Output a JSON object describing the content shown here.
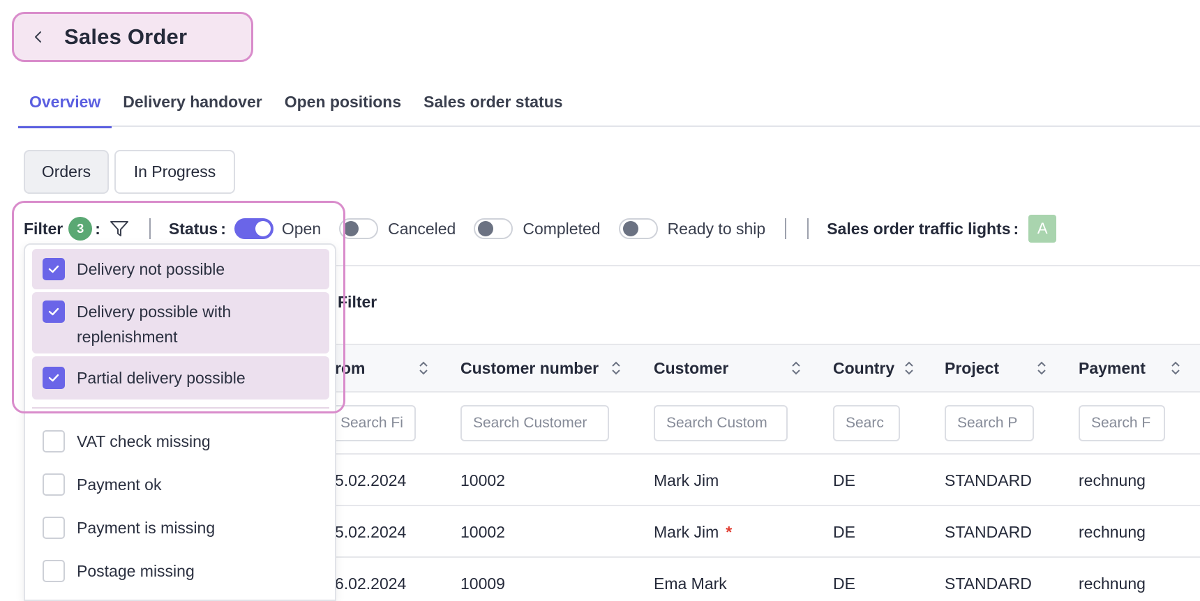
{
  "header": {
    "title": "Sales Order"
  },
  "tabs": [
    {
      "label": "Overview",
      "active": true
    },
    {
      "label": "Delivery handover",
      "active": false
    },
    {
      "label": "Open positions",
      "active": false
    },
    {
      "label": "Sales order status",
      "active": false
    }
  ],
  "view_toggle": {
    "orders_label": "Orders",
    "in_progress_label": "In Progress",
    "selected": "Orders"
  },
  "filter_bar": {
    "filter_label": "Filter",
    "filter_count": "3",
    "colon": ":",
    "status_label": "Status",
    "statuses": [
      {
        "label": "Open",
        "on": true
      },
      {
        "label": "Canceled",
        "on": false
      },
      {
        "label": "Completed",
        "on": false
      },
      {
        "label": "Ready to ship",
        "on": false
      }
    ],
    "traffic_lights_label": "Sales order traffic lights",
    "traffic_light_value": "A",
    "traffic_light_color": "#a9d4ae"
  },
  "table": {
    "filter_text": "Filter",
    "columns": [
      {
        "label": "rom",
        "placeholder": "Search Fi"
      },
      {
        "label": "Customer number",
        "placeholder": "Search Customer"
      },
      {
        "label": "Customer",
        "placeholder": "Search Custom"
      },
      {
        "label": "Country",
        "placeholder": "Searc"
      },
      {
        "label": "Project",
        "placeholder": "Search P"
      },
      {
        "label": "Payment",
        "placeholder": "Search F"
      }
    ],
    "rows": [
      {
        "from": "5.02.2024",
        "customer_number": "10002",
        "customer": "Mark Jim",
        "marker": "",
        "country": "DE",
        "project": "STANDARD",
        "payment": "rechnung"
      },
      {
        "from": "5.02.2024",
        "customer_number": "10002",
        "customer": "Mark Jim",
        "marker": "*",
        "country": "DE",
        "project": "STANDARD",
        "payment": "rechnung"
      },
      {
        "from": "6.02.2024",
        "customer_number": "10009",
        "customer": "Ema Mark",
        "marker": "",
        "country": "DE",
        "project": "STANDARD",
        "payment": "rechnung"
      }
    ]
  },
  "filter_dropdown": {
    "options": [
      {
        "label": "Delivery not possible",
        "checked": true
      },
      {
        "label": "Delivery possible with replenishment",
        "checked": true
      },
      {
        "label": "Partial delivery possible",
        "checked": true
      },
      {
        "label": "VAT check missing",
        "checked": false
      },
      {
        "label": "Payment ok",
        "checked": false
      },
      {
        "label": "Payment is missing",
        "checked": false
      },
      {
        "label": "Postage missing",
        "checked": false
      }
    ]
  },
  "colors": {
    "accent": "#5b5fe0",
    "highlight": "#d98ccb",
    "badge": "#5aa873",
    "asterisk": "#e03a2e"
  }
}
